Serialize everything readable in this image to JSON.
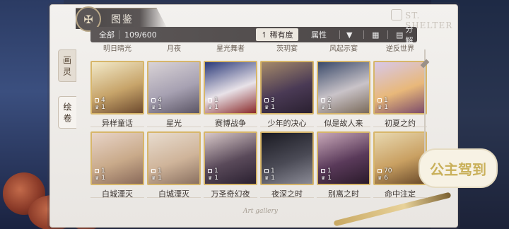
{
  "header": {
    "title": "图鉴",
    "brand": "ST. SHELTER",
    "emblem_icon": "crossed-keys-icon"
  },
  "side_tabs": [
    {
      "label": "画\n灵",
      "active": false
    },
    {
      "label": "绘\n卷",
      "active": true
    }
  ],
  "toolbar": {
    "all_label": "全部",
    "count": "109/600",
    "rarity_label": "稀有度",
    "attribute_label": "属性",
    "filter_icon": "funnel-icon",
    "grid_icon": "grid-icon",
    "split_label": "分解",
    "split_icon": "split-icon"
  },
  "peek_row": [
    "明日晴光",
    "月夜",
    "星光舞者",
    "茨玥宴",
    "风起示宴",
    "逆反世界"
  ],
  "cards": [
    {
      "name": "异样童话",
      "locks": "4",
      "crowns": "1",
      "palette": [
        "#f2e9c8",
        "#c7a46a",
        "#6d4a2e"
      ]
    },
    {
      "name": "星光",
      "locks": "4",
      "crowns": "1",
      "palette": [
        "#d9d3d6",
        "#a7a1b2",
        "#5b5565"
      ]
    },
    {
      "name": "赛博战争",
      "locks": "1",
      "crowns": "1",
      "palette": [
        "#2b3a7a",
        "#e8e2e8",
        "#8a2a2a"
      ]
    },
    {
      "name": "少年的决心",
      "locks": "3",
      "crowns": "1",
      "palette": [
        "#a58a6a",
        "#4a3a55",
        "#2a2030"
      ]
    },
    {
      "name": "似是故人来",
      "locks": "2",
      "crowns": "1",
      "palette": [
        "#3a4a6a",
        "#c9c3c8",
        "#7a6a5a"
      ]
    },
    {
      "name": "初夏之约",
      "locks": "1",
      "crowns": "1",
      "palette": [
        "#d8c8e8",
        "#e8b87a",
        "#7a4a6a"
      ]
    },
    {
      "name": "白城湮灭",
      "locks": "1",
      "crowns": "1",
      "palette": [
        "#e8d4c8",
        "#c9aa8a",
        "#8a6a5a"
      ]
    },
    {
      "name": "白城湮灭",
      "locks": "1",
      "crowns": "1",
      "palette": [
        "#e8dccf",
        "#cfb49a",
        "#8a7060"
      ]
    },
    {
      "name": "万圣奇幻夜",
      "locks": "1",
      "crowns": "1",
      "palette": [
        "#d8c8c8",
        "#5a4a5a",
        "#2a2030"
      ]
    },
    {
      "name": "夜深之时",
      "locks": "1",
      "crowns": "1",
      "palette": [
        "#1a1a22",
        "#4a4a55",
        "#8a8a95"
      ]
    },
    {
      "name": "别离之时",
      "locks": "1",
      "crowns": "1",
      "palette": [
        "#c8a8b8",
        "#5a3a5a",
        "#2a1a2a"
      ]
    },
    {
      "name": "命中注定",
      "locks": "70",
      "crowns": "6",
      "palette": [
        "#e8d8b0",
        "#c9a062",
        "#6a4a2a"
      ]
    }
  ],
  "footer": {
    "signature": "Art gallery"
  },
  "sticker": {
    "text": "公主驾到"
  }
}
